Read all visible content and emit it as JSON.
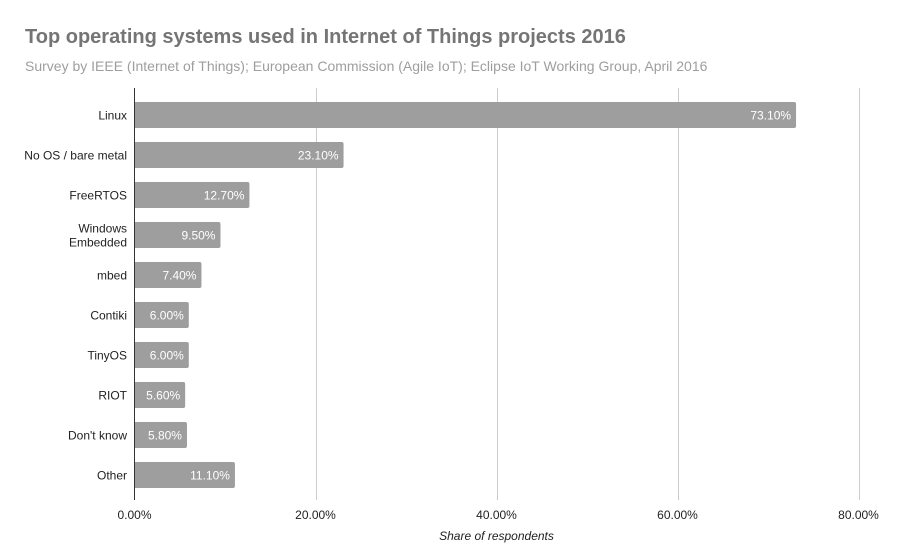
{
  "chart_data": {
    "type": "bar",
    "orientation": "horizontal",
    "title": "Top operating systems used in Internet of Things projects 2016",
    "subtitle": "Survey by IEEE (Internet of Things); European Commission (Agile IoT); Eclipse IoT Working Group, April 2016",
    "categories": [
      "Linux",
      "No OS / bare metal",
      "FreeRTOS",
      "Windows Embedded",
      "mbed",
      "Contiki",
      "TinyOS",
      "RIOT",
      "Don't know",
      "Other"
    ],
    "category_lines": [
      [
        "Linux"
      ],
      [
        "No OS / bare metal"
      ],
      [
        "FreeRTOS"
      ],
      [
        "Windows",
        "Embedded"
      ],
      [
        "mbed"
      ],
      [
        "Contiki"
      ],
      [
        "TinyOS"
      ],
      [
        "RIOT"
      ],
      [
        "Don't know"
      ],
      [
        "Other"
      ]
    ],
    "values": [
      73.1,
      23.1,
      12.7,
      9.5,
      7.4,
      6.0,
      6.0,
      5.6,
      5.8,
      11.1
    ],
    "data_labels": [
      "73.10%",
      "23.10%",
      "12.70%",
      "9.50%",
      "7.40%",
      "6.00%",
      "6.00%",
      "5.60%",
      "5.80%",
      "11.10%"
    ],
    "xlabel": "Share of respondents",
    "ylabel": "",
    "xlim": [
      0,
      80
    ],
    "xticks": [
      0,
      20,
      40,
      60,
      80
    ],
    "xtick_labels": [
      "0.00%",
      "20.00%",
      "40.00%",
      "60.00%",
      "80.00%"
    ],
    "grid": true,
    "legend": "none",
    "bar_color": "#9e9e9e"
  }
}
